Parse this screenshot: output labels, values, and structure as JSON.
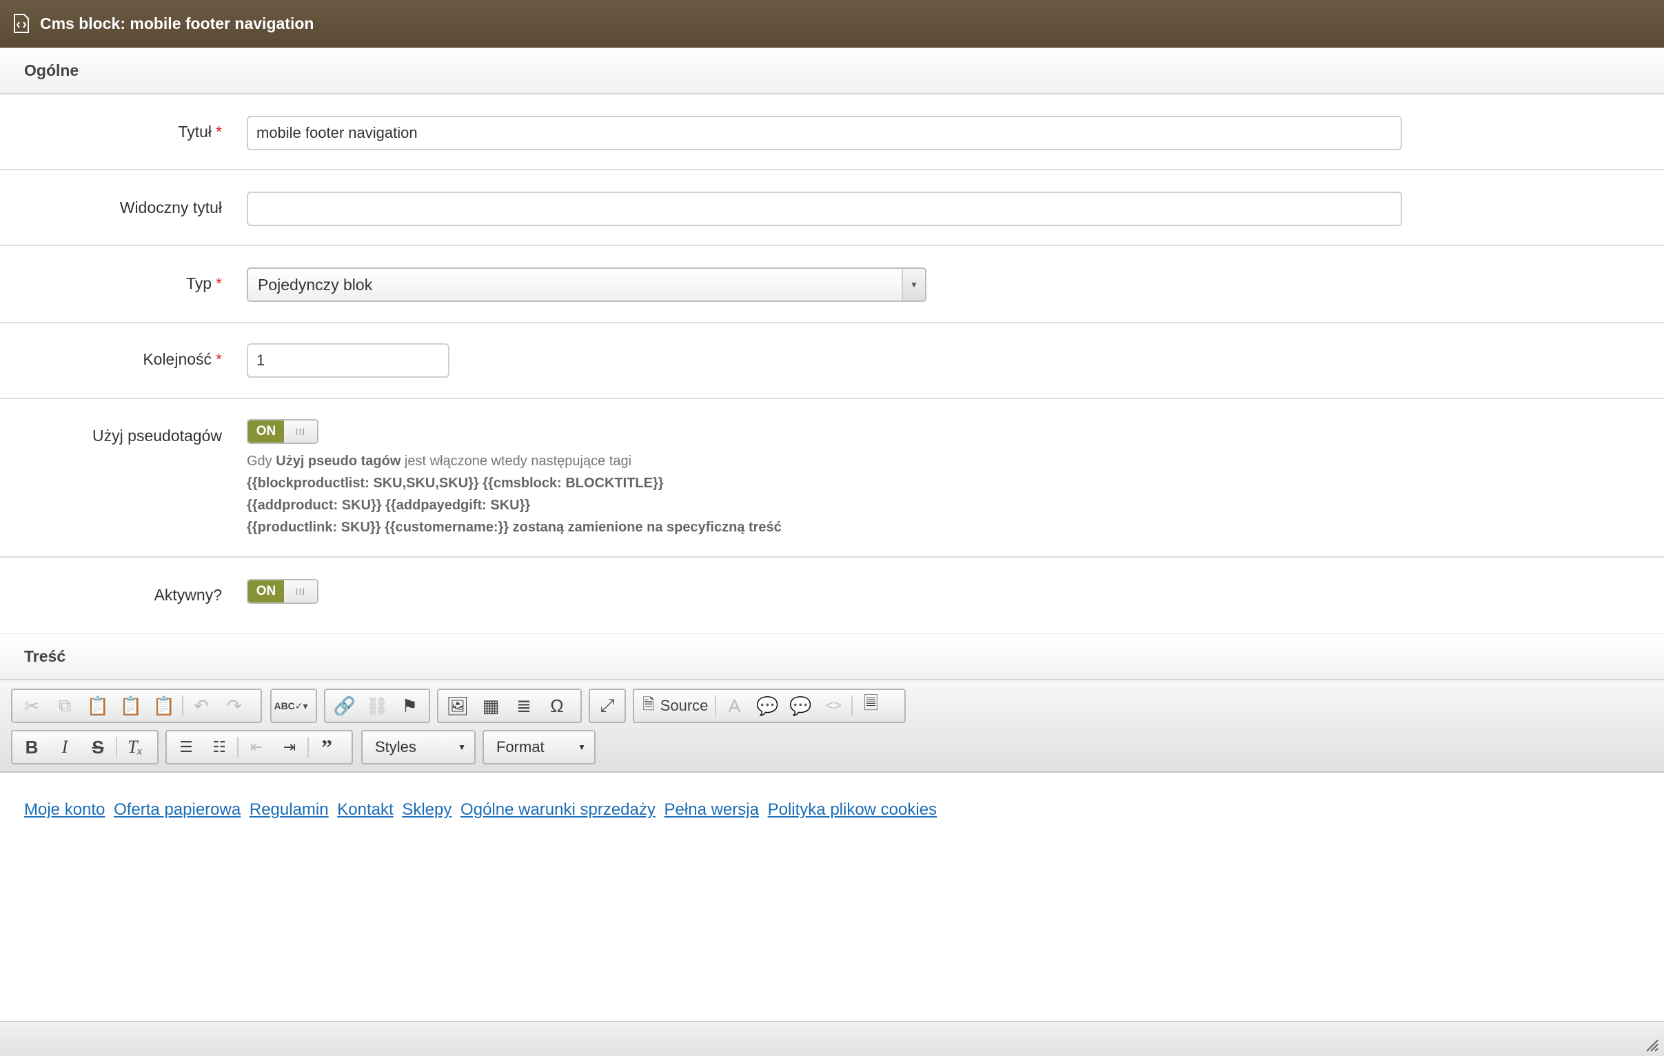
{
  "header": {
    "title": "Cms block: mobile footer navigation",
    "icon": "code-file-icon"
  },
  "sections": {
    "general": "Ogólne",
    "content": "Treść"
  },
  "form": {
    "title": {
      "label": "Tytuł",
      "value": "mobile footer navigation",
      "required": true
    },
    "visible_title": {
      "label": "Widoczny tytuł",
      "value": ""
    },
    "type": {
      "label": "Typ",
      "value": "Pojedynczy blok",
      "required": true
    },
    "order": {
      "label": "Kolejność",
      "value": "1",
      "required": true
    },
    "pseudotags": {
      "label": "Użyj pseudotagów",
      "toggle": "ON",
      "help_prefix": "Gdy ",
      "help_bold": "Użyj pseudo tagów",
      "help_suffix": " jest włączone wtedy następujące tagi",
      "help_line2": "{{blockproductlist: SKU,SKU,SKU}} {{cmsblock: BLOCKTITLE}}",
      "help_line3": "{{addproduct: SKU}} {{addpayedgift: SKU}}",
      "help_line4": "{{productlink: SKU}} {{customername:}} zostaną zamienione na specyficzną treść"
    },
    "active": {
      "label": "Aktywny?",
      "toggle": "ON"
    },
    "required_mark": "*"
  },
  "editor": {
    "source_label": "Source",
    "styles_label": "Styles",
    "format_label": "Format",
    "links": [
      "Moje konto",
      "Oferta papierowa",
      "Regulamin",
      "Kontakt",
      "Sklepy",
      "Ogólne warunki sprzedaży",
      "Pełna wersja",
      "Polityka plikow cookies"
    ]
  },
  "colors": {
    "header_bg": "#5f4e38",
    "toggle_on": "#879336",
    "link": "#1a6db8",
    "required": "#e02020"
  }
}
